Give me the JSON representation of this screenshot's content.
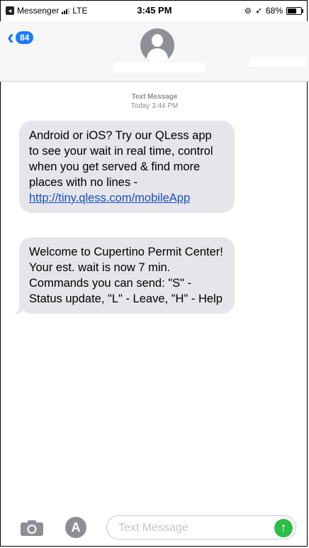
{
  "status_bar": {
    "carrier": "Messenger",
    "network": "LTE",
    "time": "3:45 PM",
    "battery": "68%"
  },
  "header": {
    "back_count": "84"
  },
  "thread": {
    "meta_label": "Text Message",
    "meta_time": "Today 3:44 PM"
  },
  "messages": [
    {
      "text": "Android or iOS? Try our QLess app to see your wait in real time, control when you get served & find more places with no lines - ",
      "link": "http://tiny.qless.com/mobileApp"
    },
    {
      "text": "Welcome to Cupertino Permit Center! Your est. wait is now 7 min.  Commands you can send: \"S\" - Status update, \"L\" - Leave, \"H\" - Help"
    }
  ],
  "composer": {
    "placeholder": "Text Message"
  },
  "colors": {
    "accent": "#1a7cf6",
    "bubble": "#e5e5ea",
    "send": "#2dbd4a"
  }
}
